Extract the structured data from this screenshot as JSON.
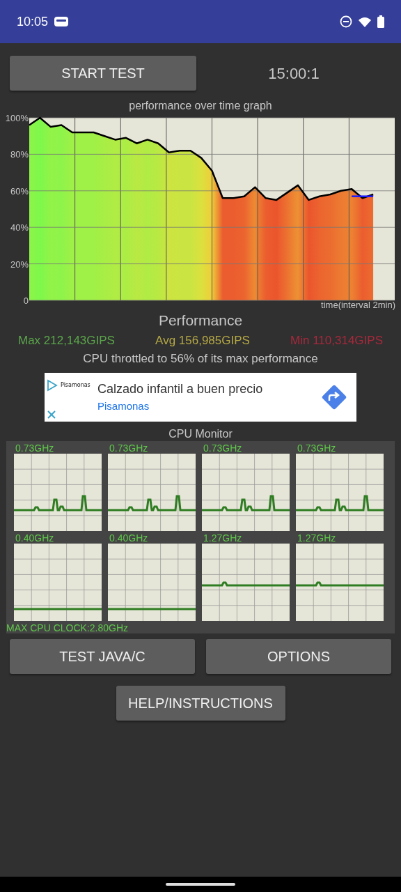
{
  "status_bar": {
    "time": "10:05"
  },
  "start_button": "START TEST",
  "timer": "15:00:1",
  "performance_graph": {
    "title": "performance over time graph",
    "chart_data": {
      "type": "area",
      "grid": true,
      "xlabel": "time(interval 2min)",
      "ylim": [
        0,
        100
      ],
      "yticks": [
        {
          "value": 0,
          "label": "0"
        },
        {
          "value": 20,
          "label": "20%"
        },
        {
          "value": 40,
          "label": "40%"
        },
        {
          "value": 60,
          "label": "60%"
        },
        {
          "value": 80,
          "label": "80%"
        },
        {
          "value": 100,
          "label": "100%"
        }
      ],
      "categories": [
        null,
        null,
        null,
        null,
        null,
        null,
        null,
        null,
        null,
        null,
        null,
        null,
        null,
        null,
        null,
        null,
        null,
        null,
        null,
        null,
        null,
        null,
        null,
        null,
        null,
        null,
        null,
        null,
        null,
        null,
        null,
        null,
        null,
        null,
        null
      ],
      "series": [
        {
          "color": "#000000",
          "values": [
            96,
            100,
            95,
            96,
            92,
            92,
            92,
            90,
            88,
            89,
            86,
            88,
            86,
            81,
            82,
            82,
            78,
            71,
            56,
            56,
            57,
            62,
            56,
            55,
            59,
            63,
            55,
            57,
            58,
            60,
            61,
            56,
            58,
            null,
            null
          ]
        },
        {
          "type": "line",
          "color": "#1a1aff",
          "values": [
            null,
            null,
            null,
            null,
            null,
            null,
            null,
            null,
            null,
            null,
            null,
            null,
            null,
            null,
            null,
            null,
            null,
            null,
            null,
            null,
            null,
            null,
            null,
            null,
            null,
            null,
            null,
            null,
            null,
            null,
            57,
            57,
            57,
            null,
            null
          ]
        }
      ]
    }
  },
  "performance": {
    "title": "Performance",
    "max": "Max 212,143GIPS",
    "avg": "Avg 156,985GIPS",
    "min": "Min 110,314GIPS",
    "throttle_note": "CPU throttled to 56% of its max performance"
  },
  "ad": {
    "logo": "Pisamonas",
    "headline": "Calzado infantil a buen precio",
    "advertiser": "Pisamonas"
  },
  "cpu_monitor": {
    "title": "CPU Monitor",
    "cores": [
      {
        "frequency": "0.73GHz",
        "kind": "spiky"
      },
      {
        "frequency": "0.73GHz",
        "kind": "spiky"
      },
      {
        "frequency": "0.73GHz",
        "kind": "spiky"
      },
      {
        "frequency": "0.73GHz",
        "kind": "spiky"
      },
      {
        "frequency": "0.40GHz",
        "kind": "low"
      },
      {
        "frequency": "0.40GHz",
        "kind": "low"
      },
      {
        "frequency": "1.27GHz",
        "kind": "mid"
      },
      {
        "frequency": "1.27GHz",
        "kind": "mid"
      }
    ],
    "max_clock": "MAX CPU CLOCK:2.80GHz"
  },
  "buttons": [
    "TEST JAVA/C",
    "OPTIONS"
  ],
  "help_button": "HELP/INSTRUCTIONS"
}
